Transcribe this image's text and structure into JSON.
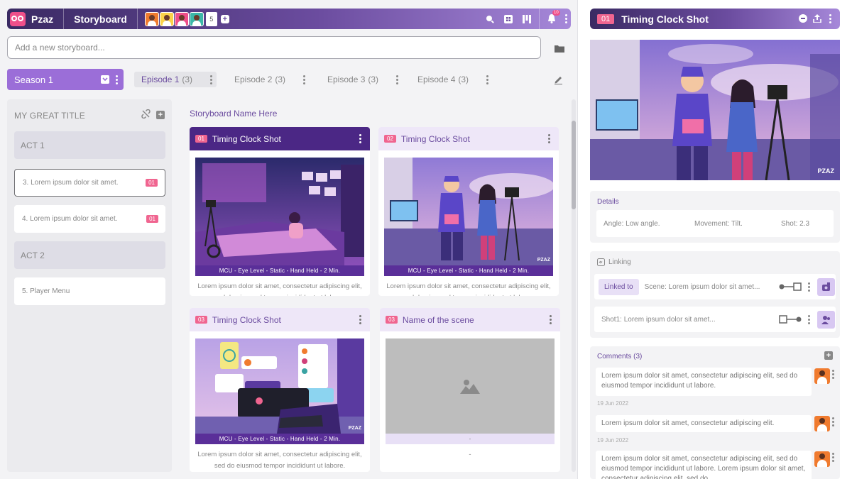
{
  "app": {
    "name": "Pzaz",
    "title": "Storyboard"
  },
  "topbar": {
    "member_extra_count": "5",
    "notification_count": "10"
  },
  "new_storyboard": {
    "placeholder": "Add a new storyboard..."
  },
  "season": {
    "label": "Season 1"
  },
  "episodes": [
    {
      "label": "Episode 1",
      "count": "(3)",
      "active": true
    },
    {
      "label": "Episode 2",
      "count": "(3)",
      "active": false
    },
    {
      "label": "Episode 3",
      "count": "(3)",
      "active": false
    },
    {
      "label": "Episode 4",
      "count": "(3)",
      "active": false
    }
  ],
  "outline": {
    "title": "MY GREAT TITLE",
    "act1": "ACT 1",
    "scene3": {
      "label": "3. Lorem ipsum dolor sit amet.",
      "num": "01"
    },
    "scene4": {
      "label": "4. Lorem ipsum dolor sit amet.",
      "num": "01"
    },
    "act2": "ACT 2",
    "scene5": {
      "label": "5. Player Menu"
    }
  },
  "storyboard": {
    "name": "Storyboard Name Here",
    "cards": [
      {
        "num": "01",
        "title": "Timing Clock Shot",
        "meta": "MCU - Eye Level - Static - Hand Held - 2 Min.",
        "desc": "Lorem ipsum dolor sit amet, consectetur adipiscing elit, sed do eiusmod tempor incididunt ut labore."
      },
      {
        "num": "02",
        "title": "Timing Clock Shot",
        "meta": "MCU - Eye Level - Static - Hand Held - 2 Min.",
        "desc": "Lorem ipsum dolor sit amet, consectetur adipiscing elit, sed do eiusmod tempor incididunt ut labore."
      },
      {
        "num": "03",
        "title": "Timing Clock Shot",
        "meta": "MCU - Eye Level - Static - Hand Held - 2 Min.",
        "desc": "Lorem ipsum dolor sit amet, consectetur adipiscing elit, sed do eiusmod tempor incididunt ut labore."
      },
      {
        "num": "03",
        "title": "Name of the scene",
        "meta": "-",
        "desc": "-"
      }
    ],
    "watermark": "PZAZ"
  },
  "detail_panel": {
    "num": "01",
    "title": "Timing Clock Shot",
    "details_title": "Details",
    "angle": "Angle:  Low angle.",
    "movement": "Movement:  Tilt.",
    "shot": "Shot:  2.3",
    "linking_title": "Linking",
    "linked_to": "Linked to",
    "link_scene": "Scene: Lorem ipsum dolor sit amet...",
    "link_shot": "Shot1: Lorem ipsum dolor sit amet...",
    "comments_title": "Comments (3)",
    "comments": [
      {
        "text": "Lorem ipsum dolor sit amet, consectetur adipiscing elit, sed do eiusmod tempor incididunt ut labore.",
        "date": "19 Jun 2022"
      },
      {
        "text": "Lorem ipsum dolor sit amet, consectetur adipiscing elit.",
        "date": "19 Jun 2022"
      },
      {
        "text": "Lorem ipsum dolor sit amet, consectetur adipiscing elit, sed do eiusmod tempor incididunt ut labore. Lorem ipsum dolor sit amet, consectetur adipiscing elit, sed do"
      }
    ]
  },
  "colors": {
    "accent": "#6b4c9f",
    "brand_pink": "#f06590",
    "season": "#9b6ed8"
  }
}
